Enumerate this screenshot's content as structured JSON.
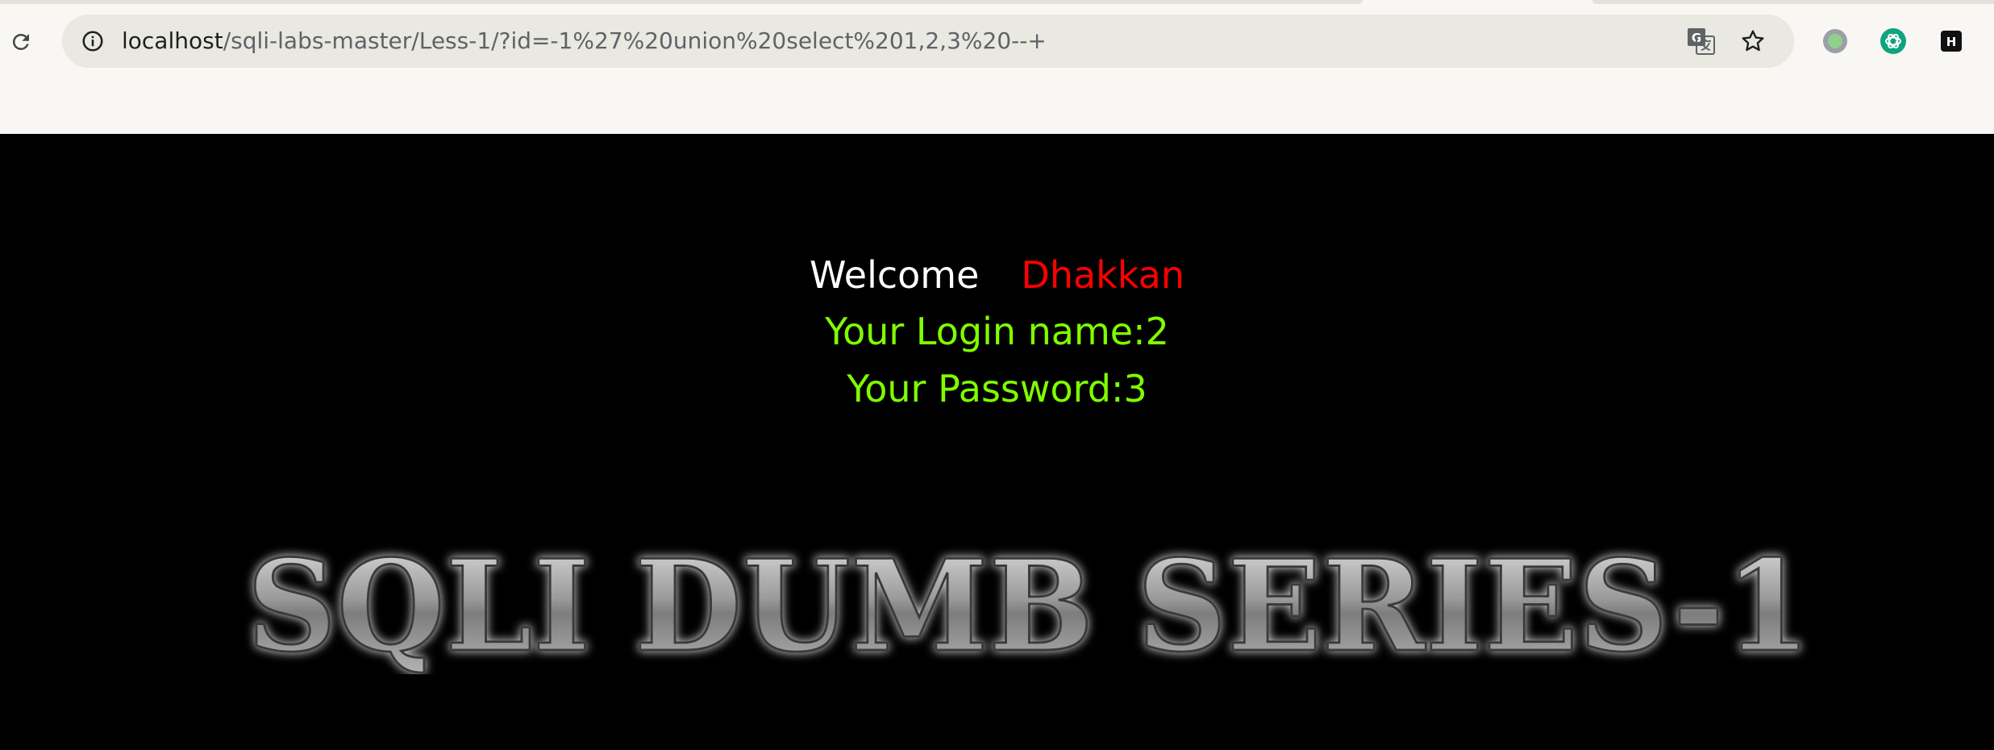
{
  "browser": {
    "url_host": "localhost",
    "url_path": "/sqli-labs-master/Less-1/?id=-1%27%20union%20select%201,2,3%20--+",
    "icons": {
      "reload": "reload-icon",
      "site_info": "info-icon",
      "translate": "translate-icon",
      "bookmark": "star-icon",
      "extensions": [
        "green-dot-extension-icon",
        "chatgpt-icon",
        "h-extension-icon"
      ]
    }
  },
  "page": {
    "welcome_label": "Welcome",
    "username": "Dhakkan",
    "login_line": "Your Login name:2",
    "password_line": "Your Password:3",
    "banner_text": "SQLI DUMB SERIES-1"
  },
  "colors": {
    "background": "#000000",
    "welcome": "#ffffff",
    "username": "#ff0000",
    "result_text": "#7fff00"
  }
}
